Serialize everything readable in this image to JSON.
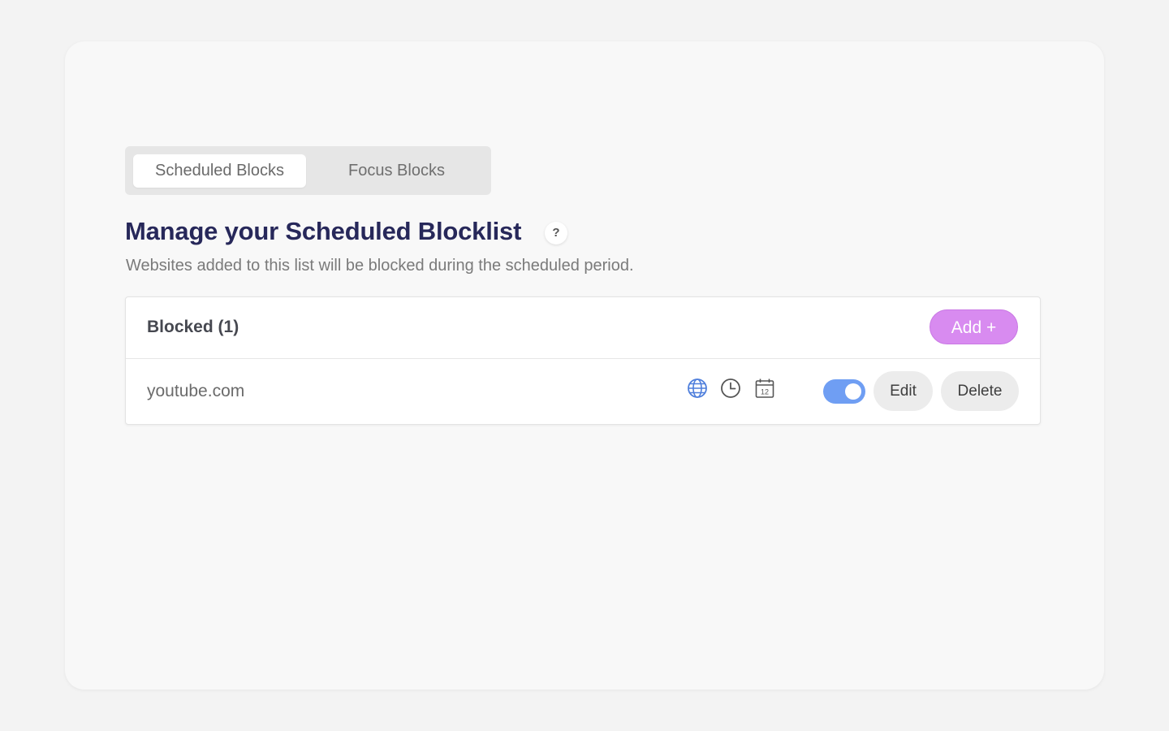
{
  "tabs": [
    {
      "label": "Scheduled Blocks",
      "active": true
    },
    {
      "label": "Focus Blocks",
      "active": false
    }
  ],
  "header": {
    "title": "Manage your Scheduled Blocklist",
    "help_label": "?",
    "subtitle": "Websites added to this list will be blocked during the scheduled period."
  },
  "list": {
    "title": "Blocked (1)",
    "add_label": "Add +",
    "items": [
      {
        "site": "youtube.com",
        "icons": [
          "globe-icon",
          "clock-icon",
          "calendar-icon"
        ],
        "calendar_day": "12",
        "enabled": true,
        "edit_label": "Edit",
        "delete_label": "Delete"
      }
    ]
  },
  "colors": {
    "title": "#27285a",
    "accent_add": "#d88bf0",
    "toggle_on": "#6f9ef3",
    "globe": "#4f7fdc"
  }
}
